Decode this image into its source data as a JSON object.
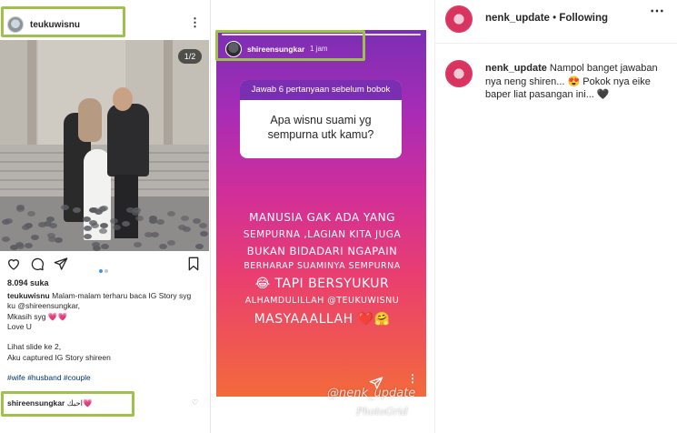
{
  "post": {
    "username": "teukuwisnu",
    "slide_counter": "1/2",
    "likes": "8.094 suka",
    "caption_user": "teukuwisnu",
    "caption_lines": [
      "Malam-malam terharu baca IG Story syg",
      "ku @shireensungkar,",
      "Mkasih syg 💗💗",
      "Love U",
      "",
      "Lihat slide ke 2,",
      "Aku captured IG Story shireen",
      "",
      "#wife #husband #couple"
    ],
    "comment_user": "shireensungkar",
    "comment_text": "احبك💗"
  },
  "story": {
    "username": "shireensungkar",
    "time": "1 jam",
    "question_header": "Jawab 6 pertanyaan sebelum bobok",
    "question": "Apa wisnu suami yg sempurna utk kamu?",
    "answer_lines": [
      "MANUSIA GAK ADA YANG",
      "SEMPURNA ,LAGIAN KITA JUGA",
      "BUKAN BIDADARI NGAPAIN",
      "BERHARAP SUAMINYA SEMPURNA",
      "😂 TAPI BERSYUKUR",
      "ALHAMDULILLAH @TEUKUWISNU",
      "MASYAAALLAH ❤️🤗"
    ],
    "watermark": "@nenk_update",
    "watermark_app": "PhotoGrid"
  },
  "right_panel": {
    "username": "nenk_update",
    "separator": " • ",
    "follow_status": "Following",
    "comment_user": "nenk_update",
    "comment_text": "Nampol banget jawaban nya neng shiren... 😍 Pokok nya eike baper liat pasangan ini... 🖤"
  },
  "colors": {
    "highlight_box": "#9ec14b",
    "story_top": "#7b2fb4",
    "story_bottom": "#f36a3b",
    "accent_ig_blue": "#3897f0"
  }
}
